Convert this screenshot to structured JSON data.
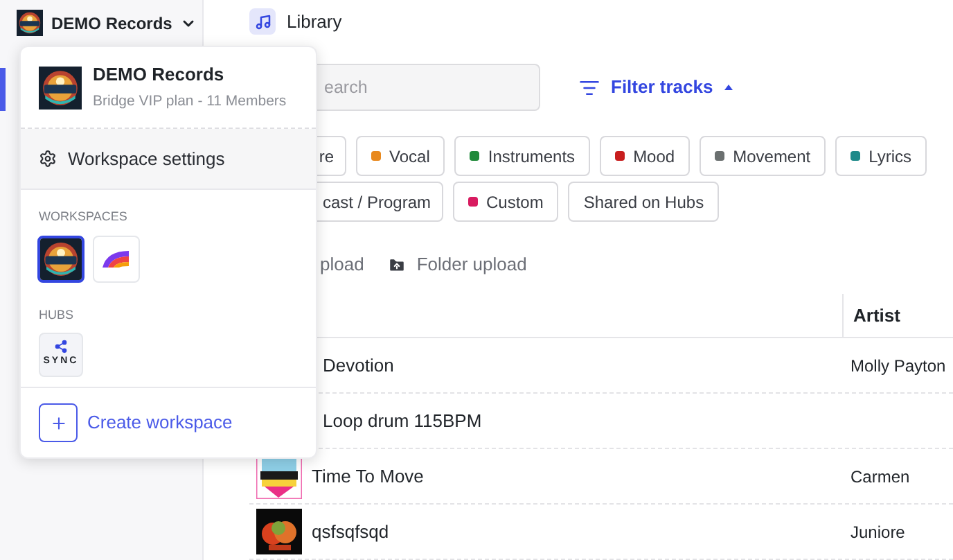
{
  "sidebar": {
    "workspace_name": "DEMO Records"
  },
  "header": {
    "title": "Library"
  },
  "search": {
    "placeholder": "earch"
  },
  "filter": {
    "label": "Filter tracks",
    "expanded": true
  },
  "tag_rows": [
    [
      {
        "label": "re"
      },
      {
        "label": "Vocal",
        "color": "#e8891e"
      },
      {
        "label": "Instruments",
        "color": "#1f8a3a"
      },
      {
        "label": "Mood",
        "color": "#c81e1e"
      },
      {
        "label": "Movement",
        "color": "#6b7070"
      },
      {
        "label": "Lyrics",
        "color": "#1e8a8a"
      }
    ],
    [
      {
        "label": "cast / Program"
      },
      {
        "label": "Custom",
        "color": "#d81b60"
      },
      {
        "label": "Shared on Hubs"
      }
    ]
  ],
  "uploads": [
    {
      "label": "pload",
      "kind": "text"
    },
    {
      "label": "Folder upload",
      "kind": "folder"
    }
  ],
  "table": {
    "columns": [
      "Artist"
    ],
    "rows": [
      {
        "title": "Devotion",
        "artist": "Molly Payton"
      },
      {
        "title": "Loop drum 115BPM"
      },
      {
        "title": "Time To Move",
        "artist": "Carmen"
      },
      {
        "title": "qsfsqfsqd",
        "artist": "Juniore"
      }
    ]
  },
  "menu": {
    "name": "DEMO Records",
    "plan": "Bridge VIP plan - 11 Members",
    "settings": "Workspace settings",
    "workspaces_label": "WORKSPACES",
    "workspaces": [
      {
        "kind": "demo",
        "selected": true
      },
      {
        "kind": "rainbow",
        "selected": false
      }
    ],
    "hubs_label": "HUBS",
    "hubs": [
      {
        "label": "SYNC"
      }
    ],
    "create": "Create workspace"
  }
}
